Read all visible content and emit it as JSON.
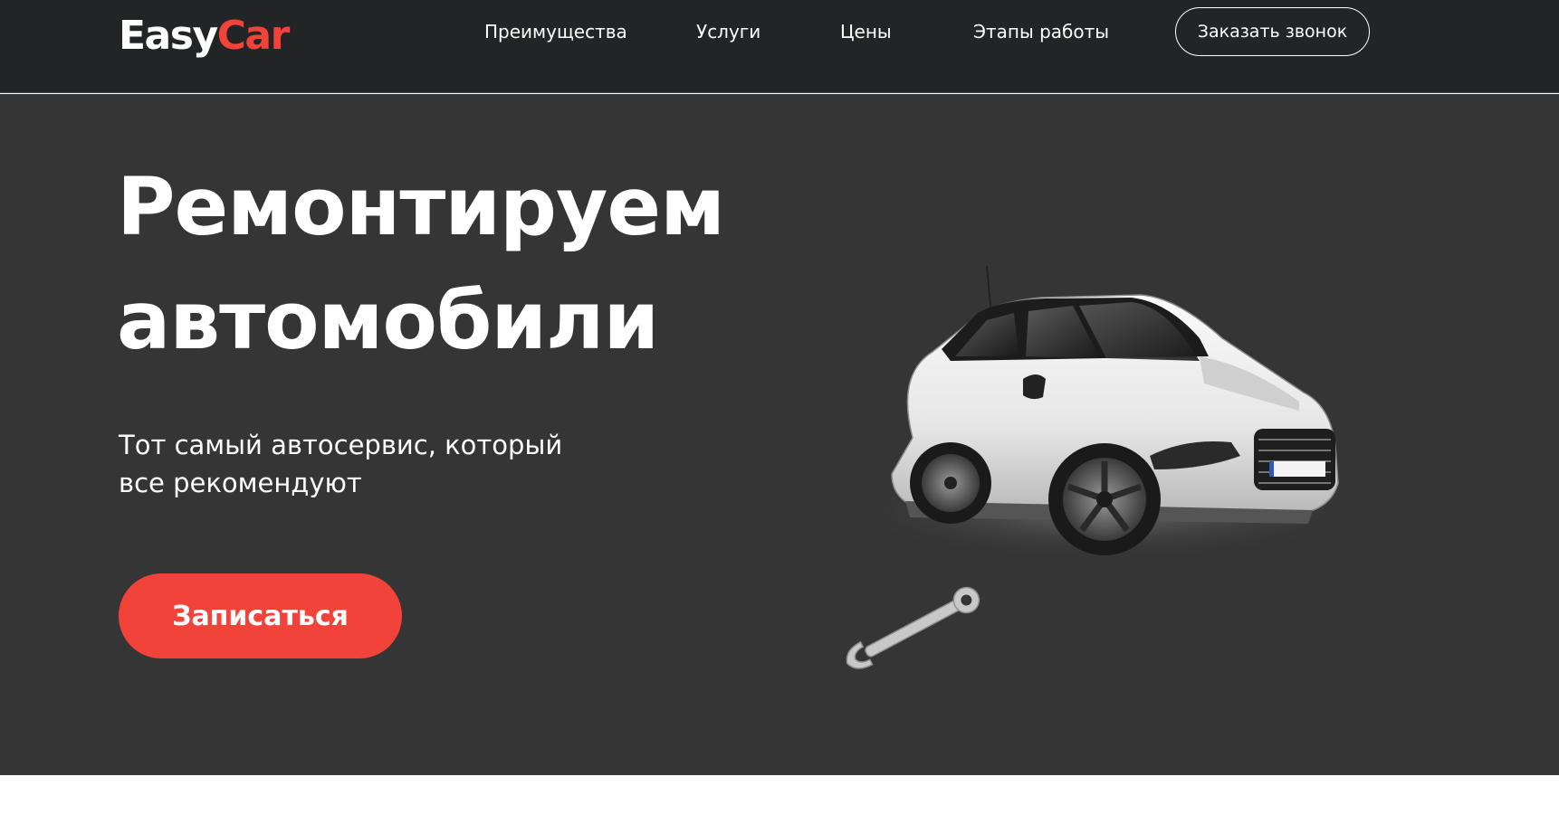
{
  "brand": {
    "part1": "Easy",
    "part2": "Car",
    "accent_color": "#f2433a"
  },
  "nav": {
    "items": [
      {
        "label": "Преимущества"
      },
      {
        "label": "Услуги"
      },
      {
        "label": "Цены"
      },
      {
        "label": "Этапы работы"
      }
    ],
    "callback_label": "Заказать звонок"
  },
  "hero": {
    "title_line1": "Ремонтируем",
    "title_line2": "автомобили",
    "subtitle_line1": "Тот самый автосервис, который",
    "subtitle_line2": "все рекомендуют",
    "cta_label": "Записаться",
    "image": "car-image",
    "decor": "wrench-icon",
    "background_color": "#353535"
  },
  "colors": {
    "header_bg": "#232426",
    "hero_bg": "#353535",
    "accent": "#f2433a"
  }
}
